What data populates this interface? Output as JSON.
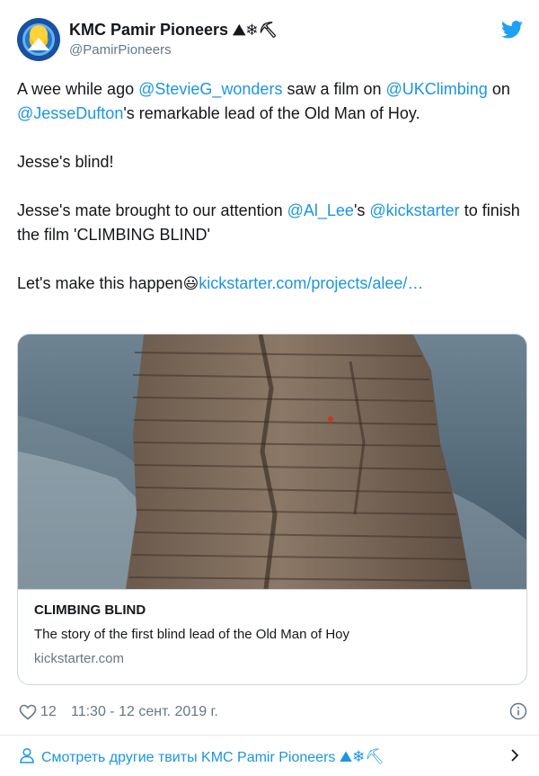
{
  "author": {
    "display_name": "KMC Pamir Pioneers",
    "handle": "@PamirPioneers",
    "name_emojis": "⛰❄⛏"
  },
  "tweet": {
    "line1": {
      "t1": "A wee while ago ",
      "mention1": "@StevieG_wonders",
      "t2": " saw a film on ",
      "mention2": "@UKClimbing",
      "t3": " on ",
      "mention3": "@JesseDufton",
      "t4": "'s remarkable lead of the Old Man of Hoy."
    },
    "line2": "Jesse's blind!",
    "line3": {
      "t1": "Jesse's mate brought to our attention ",
      "mention1": "@Al_Lee",
      "t2": "'s ",
      "mention2": "@kickstarter",
      "t3": " to finish the film 'CLIMBING BLIND'"
    },
    "line4": {
      "t1": "Let's make this happen",
      "emoji": "😃",
      "link": "kickstarter.com/projects/alee/…"
    }
  },
  "card": {
    "title": "CLIMBING BLIND",
    "description": "The story of the first blind lead of the Old Man of Hoy",
    "domain": "kickstarter.com"
  },
  "meta": {
    "likes": "12",
    "timestamp": "11:30 - 12 сент. 2019 г."
  },
  "footer": {
    "label": "Смотреть другие твиты KMC Pamir Pioneers",
    "emojis": "⛰❄⛏"
  },
  "colors": {
    "link": "#1b95e0",
    "text": "#14171a",
    "secondary": "#657786",
    "twitter_blue": "#1da1f2"
  },
  "icons": [
    "twitter-bird-icon",
    "heart-icon",
    "info-icon",
    "person-icon",
    "chevron-right-icon"
  ]
}
